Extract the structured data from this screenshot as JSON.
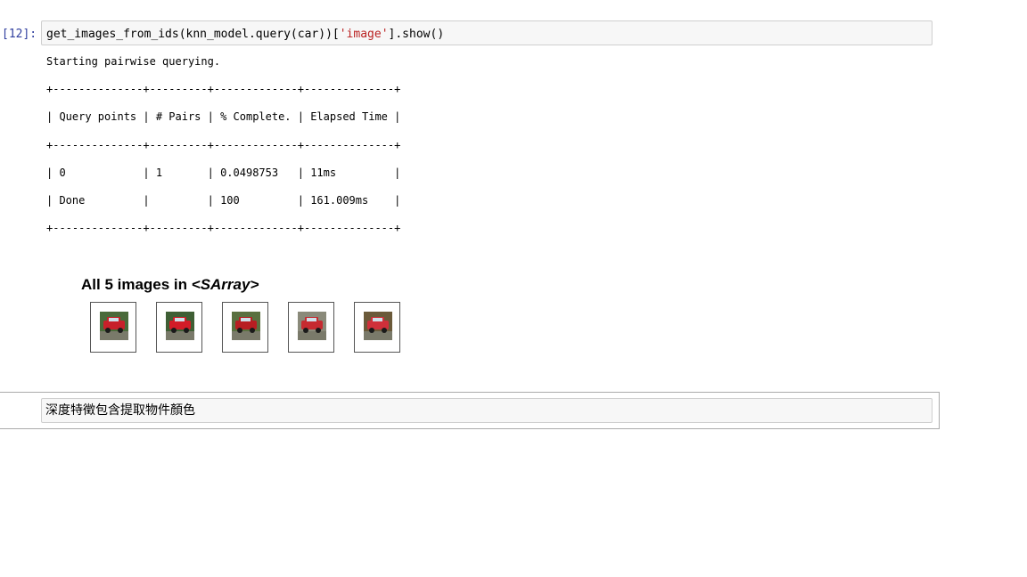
{
  "cell_in": {
    "prompt": "[12]:",
    "code_prefix": "get_images_from_ids(knn_model.query(car))[",
    "code_string": "'image'",
    "code_suffix": "].show()"
  },
  "output": {
    "status": "Starting pairwise querying.",
    "table_border": "+--------------+---------+-------------+--------------+",
    "table_header": "| Query points | # Pairs | % Complete. | Elapsed Time |",
    "table_rows": [
      "| 0            | 1       | 0.0498753   | 11ms         |",
      "| Done         |         | 100         | 161.009ms    |"
    ]
  },
  "sarray": {
    "title_prefix": "All 5 images in ",
    "title_type": "<SArray>",
    "thumbnails": [
      {
        "label": "red car thumbnail 1",
        "body": "#c8202a",
        "bg": "#4a6a3a"
      },
      {
        "label": "red car thumbnail 2",
        "body": "#d21c28",
        "bg": "#3f5f35"
      },
      {
        "label": "red car thumbnail 3",
        "body": "#b81e22",
        "bg": "#5a7040"
      },
      {
        "label": "red car thumbnail 4",
        "body": "#c62a30",
        "bg": "#8a8a7a"
      },
      {
        "label": "red car thumbnail 5",
        "body": "#d0303a",
        "bg": "#6b5a3a"
      }
    ]
  },
  "markdown_cell": {
    "text": "深度特徵包含提取物件顏色"
  }
}
